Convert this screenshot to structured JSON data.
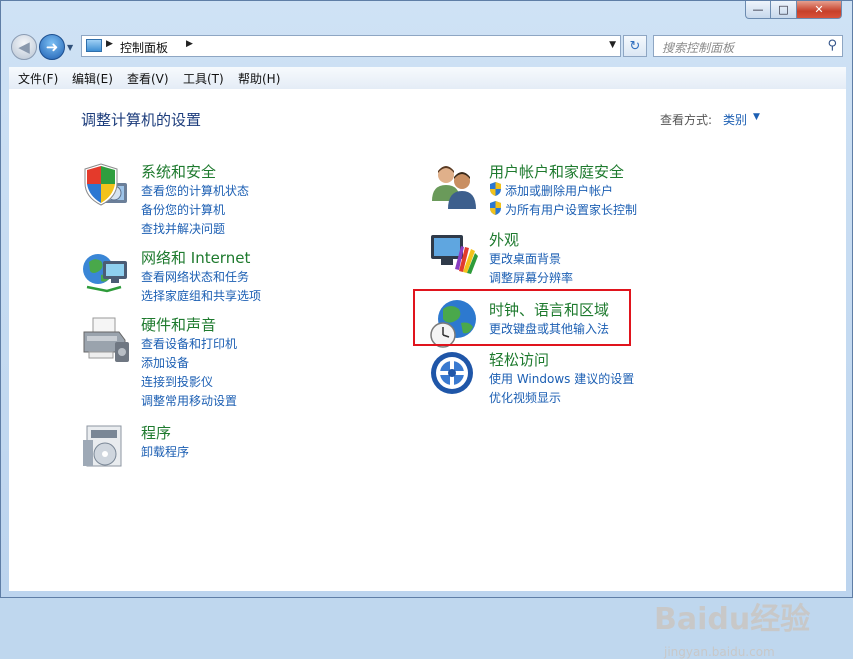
{
  "window": {
    "controls": {
      "minimize": "—",
      "maximize": "□",
      "close": "✕"
    }
  },
  "nav": {
    "back_icon": "◀",
    "forward_icon": "➜",
    "history_icon": "▼",
    "breadcrumb": "控制面板",
    "address_dropdown": "▼",
    "refresh_icon": "↻",
    "search_placeholder": "搜索控制面板",
    "search_icon": "⚲"
  },
  "menu": {
    "file": "文件(F)",
    "edit": "编辑(E)",
    "view": "查看(V)",
    "tools": "工具(T)",
    "help": "帮助(H)"
  },
  "main": {
    "heading": "调整计算机的设置",
    "view_by_label": "查看方式:",
    "view_by_value": "类别"
  },
  "categories": {
    "system": {
      "title": "系统和安全",
      "icon": "shield-computer-icon",
      "links": [
        "查看您的计算机状态",
        "备份您的计算机",
        "查找并解决问题"
      ]
    },
    "network": {
      "title": "网络和 Internet",
      "icon": "network-globe-icon",
      "links": [
        "查看网络状态和任务",
        "选择家庭组和共享选项"
      ]
    },
    "hardware": {
      "title": "硬件和声音",
      "icon": "printer-icon",
      "links": [
        "查看设备和打印机",
        "添加设备",
        "连接到投影仪",
        "调整常用移动设置"
      ]
    },
    "programs": {
      "title": "程序",
      "icon": "programs-icon",
      "links": [
        "卸载程序"
      ]
    },
    "accounts": {
      "title": "用户帐户和家庭安全",
      "icon": "users-icon",
      "links": [
        "添加或删除用户帐户",
        "为所有用户设置家长控制"
      ]
    },
    "appearance": {
      "title": "外观",
      "icon": "monitor-palette-icon",
      "links": [
        "更改桌面背景",
        "调整屏幕分辨率"
      ]
    },
    "clock": {
      "title": "时钟、语言和区域",
      "icon": "globe-clock-icon",
      "links": [
        "更改键盘或其他输入法"
      ]
    },
    "ease": {
      "title": "轻松访问",
      "icon": "ease-of-access-icon",
      "links": [
        "使用 Windows 建议的设置",
        "优化视频显示"
      ]
    }
  },
  "watermark": {
    "logo": "Baidu经验",
    "url": "jingyan.baidu.com"
  },
  "colors": {
    "category_title": "#1e7a2e",
    "link": "#1c5fb3",
    "heading": "#1d3d7c",
    "highlight": "#e0141d"
  }
}
